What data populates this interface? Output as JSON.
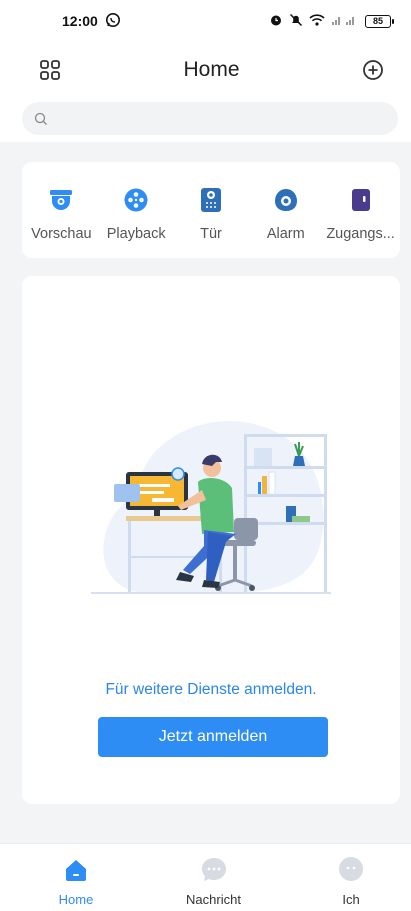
{
  "status_bar": {
    "time": "12:00",
    "battery": "85"
  },
  "header": {
    "title": "Home"
  },
  "search": {
    "placeholder": ""
  },
  "quick_actions": [
    {
      "label": "Vorschau",
      "icon": "camera-dome-icon",
      "color": "#2d8df5"
    },
    {
      "label": "Playback",
      "icon": "playback-reel-icon",
      "color": "#2d8df5"
    },
    {
      "label": "Tür",
      "icon": "intercom-door-icon",
      "color": "#2d6fb8"
    },
    {
      "label": "Alarm",
      "icon": "alarm-eye-icon",
      "color": "#2d6fb8"
    },
    {
      "label": "Zugangs...",
      "icon": "access-card-icon",
      "color": "#4a3b8c"
    }
  ],
  "main": {
    "prompt": "Für weitere Dienste anmelden.",
    "login_button": "Jetzt anmelden"
  },
  "tabs": [
    {
      "label": "Home",
      "icon": "home-icon",
      "active": true
    },
    {
      "label": "Nachricht",
      "icon": "message-bubble-icon",
      "active": false
    },
    {
      "label": "Ich",
      "icon": "profile-bubble-icon",
      "active": false
    }
  ],
  "colors": {
    "accent": "#2d8df5",
    "prompt_text": "#2a86e8",
    "background": "#f3f4f6",
    "inactive_icon": "#d7dbe2"
  }
}
